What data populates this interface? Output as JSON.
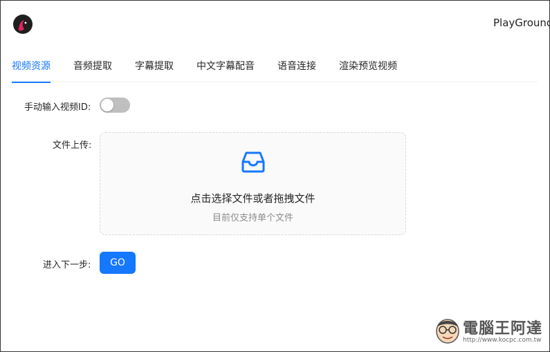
{
  "header": {
    "title": "PlayGround"
  },
  "tabs": [
    {
      "label": "视频资源",
      "active": true
    },
    {
      "label": "音频提取",
      "active": false
    },
    {
      "label": "字幕提取",
      "active": false
    },
    {
      "label": "中文字幕配音",
      "active": false
    },
    {
      "label": "语音连接",
      "active": false
    },
    {
      "label": "渲染预览视频",
      "active": false
    }
  ],
  "form": {
    "manual_id_label": "手动输入视频ID:",
    "manual_id_enabled": false,
    "upload_label": "文件上传:",
    "upload_text": "点击选择文件或者拖拽文件",
    "upload_hint": "目前仅支持单个文件",
    "next_label": "进入下一步:",
    "go_label": "GO"
  },
  "watermark": {
    "title": "電腦王阿達",
    "url": "http://www.kocpc.com.tw"
  },
  "colors": {
    "accent": "#1677ff",
    "switch_off": "#bfbfbf",
    "logo_bg": "#1f1f1f",
    "logo_accent": "#e0245e"
  }
}
